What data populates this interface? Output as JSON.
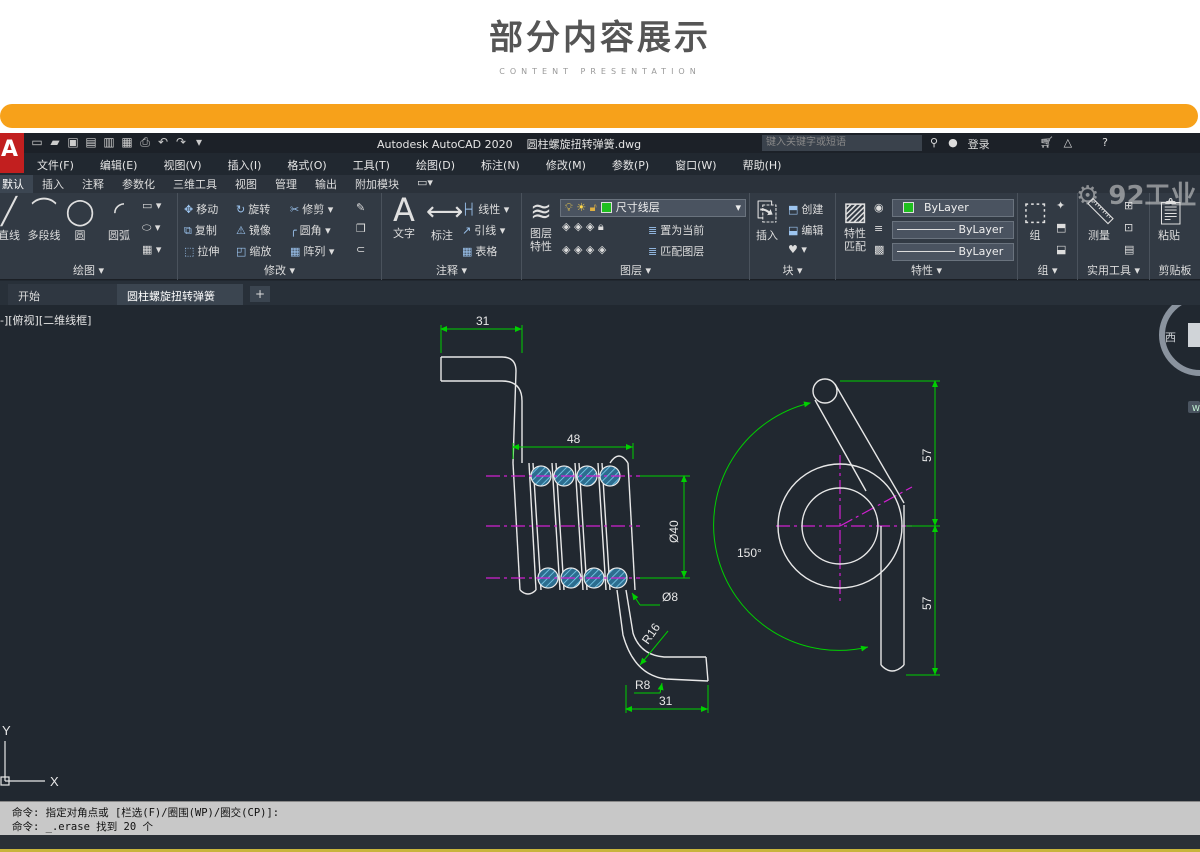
{
  "banner": {
    "title": "部分内容展示",
    "subtitle": "CONTENT PRESENTATION"
  },
  "app": {
    "logo_text": "A",
    "title": "Autodesk AutoCAD 2020",
    "filename": "圆柱螺旋扭转弹簧.dwg",
    "search_placeholder": "键入关键字或短语",
    "login": "登录"
  },
  "menu": [
    "文件(F)",
    "编辑(E)",
    "视图(V)",
    "插入(I)",
    "格式(O)",
    "工具(T)",
    "绘图(D)",
    "标注(N)",
    "修改(M)",
    "参数(P)",
    "窗口(W)",
    "帮助(H)"
  ],
  "ribbon_tabs": [
    "默认",
    "插入",
    "注释",
    "参数化",
    "三维工具",
    "视图",
    "管理",
    "输出",
    "附加模块"
  ],
  "panels": {
    "draw": {
      "label": "绘图",
      "line": "直线",
      "pline": "多段线",
      "circle": "圆",
      "arc": "圆弧"
    },
    "modify": {
      "label": "修改",
      "move": "移动",
      "rotate": "旋转",
      "trim": "修剪",
      "copy": "复制",
      "mirror": "镜像",
      "fillet": "圆角",
      "stretch": "拉伸",
      "scale": "缩放",
      "array": "阵列"
    },
    "annotation": {
      "label": "注释",
      "text": "文字",
      "dim": "标注",
      "linear": "线性",
      "leader": "引线",
      "table": "表格"
    },
    "layers": {
      "label": "图层",
      "props": "图层特性",
      "current_layer": "尺寸线层",
      "set_current": "置为当前",
      "match": "匹配图层"
    },
    "block": {
      "label": "块",
      "insert": "插入",
      "create": "创建",
      "edit": "编辑"
    },
    "properties": {
      "label": "特性",
      "match": "特性匹配",
      "color": "ByLayer",
      "linetype": "ByLayer",
      "lineweight": "ByLayer"
    },
    "groups": {
      "label": "组",
      "group": "组"
    },
    "utilities": {
      "label": "实用工具",
      "measure": "测量"
    },
    "clipboard": {
      "label": "剪贴板",
      "paste": "粘贴"
    }
  },
  "doc_tabs": {
    "start": "开始",
    "current": "圆柱螺旋扭转弹簧*"
  },
  "viewport": {
    "label": "-][俯视][二维线框]",
    "compass_west": "西",
    "watermark": "92工业"
  },
  "drawing": {
    "dims": {
      "top_width": "31",
      "coil_length": "48",
      "diameter": "Ø40",
      "wire_dia": "Ø8",
      "bend_radius": "R16",
      "end_radius": "R8",
      "bottom_width": "31",
      "angle": "150°",
      "upper_height": "57",
      "lower_height": "57"
    },
    "axis_x": "X",
    "axis_y": "Y"
  },
  "command": {
    "line1": "命令: 指定对角点或 [栏选(F)/圈围(WP)/圈交(CP)]:",
    "line2": "命令: _.erase 找到 20 个"
  },
  "colors": {
    "accent_orange": "#f7a11a",
    "canvas_bg": "#212830",
    "dim_green": "#00d000",
    "center_magenta": "#d020d0",
    "section_cyan": "#4fb0d0"
  }
}
